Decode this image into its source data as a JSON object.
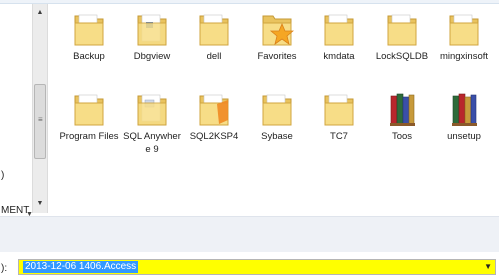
{
  "nav": {
    "items": [
      ")",
      "MENT"
    ]
  },
  "files": [
    {
      "name": "Backup",
      "icon": "folder-icon",
      "variant": "plain"
    },
    {
      "name": "Dbgview",
      "icon": "folder-icon",
      "variant": "doc"
    },
    {
      "name": "dell",
      "icon": "folder-icon",
      "variant": "plain"
    },
    {
      "name": "Favorites",
      "icon": "favorites-folder-icon",
      "variant": "star"
    },
    {
      "name": "kmdata",
      "icon": "folder-icon",
      "variant": "plain"
    },
    {
      "name": "LockSQLDB",
      "icon": "folder-icon",
      "variant": "plain"
    },
    {
      "name": "mingxinsoft",
      "icon": "folder-icon",
      "variant": "plain"
    },
    {
      "name": "Program Files",
      "icon": "folder-icon",
      "variant": "plain"
    },
    {
      "name": "SQL Anywhere 9",
      "icon": "folder-icon",
      "variant": "doc"
    },
    {
      "name": "SQL2KSP4",
      "icon": "folder-icon",
      "variant": "orange"
    },
    {
      "name": "Sybase",
      "icon": "folder-icon",
      "variant": "plain"
    },
    {
      "name": "TC7",
      "icon": "folder-icon",
      "variant": "plain"
    },
    {
      "name": "Toos",
      "icon": "folder-icon",
      "variant": "books"
    },
    {
      "name": "unsetup",
      "icon": "folder-icon",
      "variant": "books"
    }
  ],
  "filename": {
    "label": "):",
    "value": "2013-12-06 1406.Access",
    "highlight": "#ffff00",
    "selection": "#3399ff"
  }
}
